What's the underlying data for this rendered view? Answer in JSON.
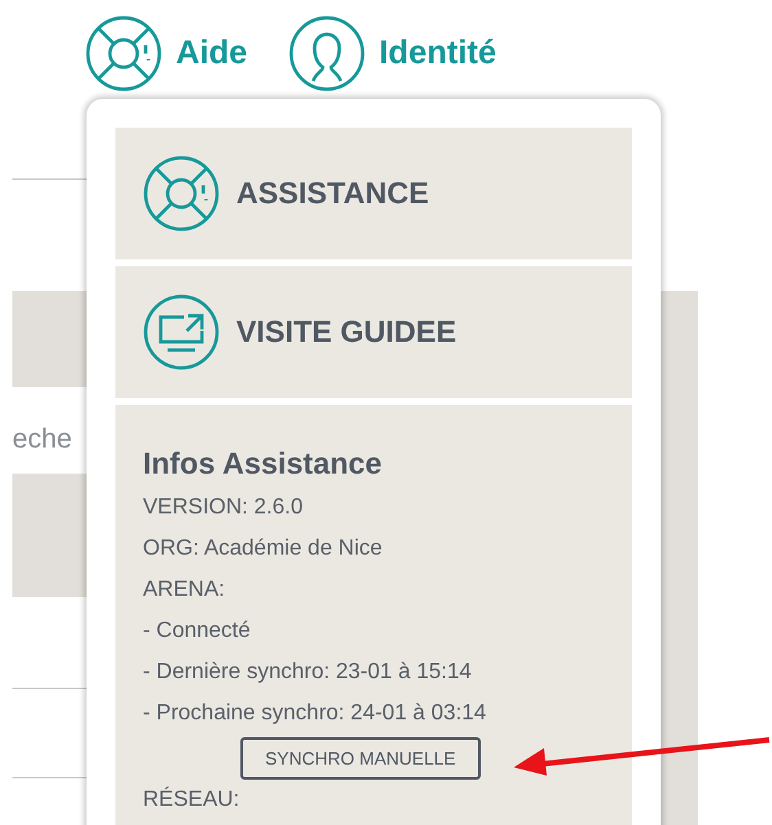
{
  "nav": [
    {
      "label": "Aide",
      "kind": "lifebuoy"
    },
    {
      "label": "Identité",
      "kind": "user"
    }
  ],
  "background": {
    "search_text": "eche"
  },
  "menu": {
    "items": [
      {
        "label": "ASSISTANCE",
        "kind": "lifebuoy"
      },
      {
        "label": "VISITE GUIDEE",
        "kind": "monitor"
      }
    ],
    "info": {
      "title": "Infos Assistance",
      "lines": [
        "VERSION: 2.6.0",
        "ORG: Académie de Nice",
        "ARENA:",
        "- Connecté",
        "- Dernière synchro: 23-01 à 15:14",
        "- Prochaine synchro: 24-01 à 03:14"
      ],
      "button": "SYNCHRO MANUELLE",
      "after_lines": [
        "RÉSEAU:"
      ]
    }
  }
}
